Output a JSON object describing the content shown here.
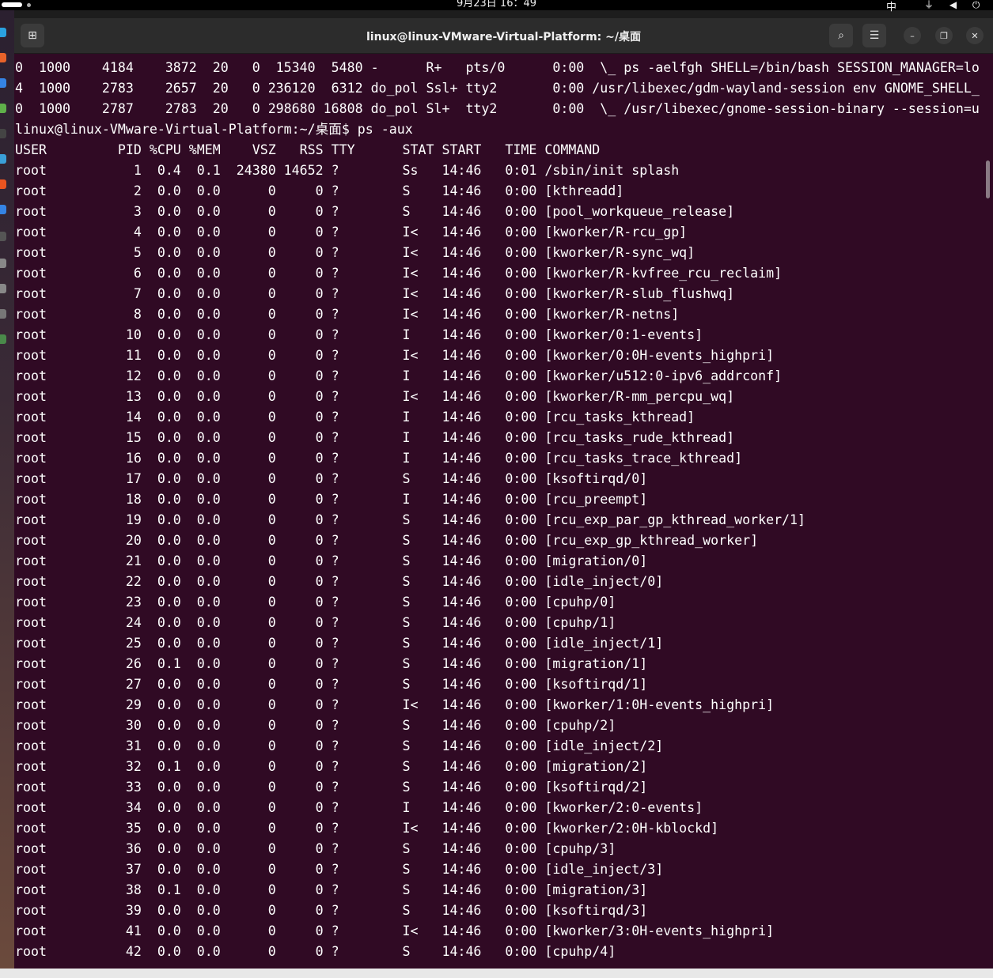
{
  "topbar": {
    "clock": "9月23日 16：49",
    "input_method": "中",
    "system_icons": "⏚ ◀ ⏻"
  },
  "window": {
    "title": "linux@linux-VMware-Virtual-Platform: ~/桌面",
    "new_tab_icon": "⊞",
    "search_icon": "⌕",
    "menu_icon": "☰",
    "minimize_icon": "–",
    "maximize_icon": "❐",
    "close_icon": "✕"
  },
  "terminal": {
    "lines": [
      "0  1000    4184    3872  20   0  15340  5480 -      R+   pts/0      0:00  \\_ ps -aelfgh SHELL=/bin/bash SESSION_MANAGER=lo",
      "4  1000    2783    2657  20   0 236120  6312 do_pol Ssl+ tty2       0:00 /usr/libexec/gdm-wayland-session env GNOME_SHELL_",
      "0  1000    2787    2783  20   0 298680 16808 do_pol Sl+  tty2       0:00  \\_ /usr/libexec/gnome-session-binary --session=u",
      "linux@linux-VMware-Virtual-Platform:~/桌面$ ps -aux",
      "USER         PID %CPU %MEM    VSZ   RSS TTY      STAT START   TIME COMMAND",
      "root           1  0.4  0.1  24380 14652 ?        Ss   14:46   0:01 /sbin/init splash",
      "root           2  0.0  0.0      0     0 ?        S    14:46   0:00 [kthreadd]",
      "root           3  0.0  0.0      0     0 ?        S    14:46   0:00 [pool_workqueue_release]",
      "root           4  0.0  0.0      0     0 ?        I<   14:46   0:00 [kworker/R-rcu_gp]",
      "root           5  0.0  0.0      0     0 ?        I<   14:46   0:00 [kworker/R-sync_wq]",
      "root           6  0.0  0.0      0     0 ?        I<   14:46   0:00 [kworker/R-kvfree_rcu_reclaim]",
      "root           7  0.0  0.0      0     0 ?        I<   14:46   0:00 [kworker/R-slub_flushwq]",
      "root           8  0.0  0.0      0     0 ?        I<   14:46   0:00 [kworker/R-netns]",
      "root          10  0.0  0.0      0     0 ?        I    14:46   0:00 [kworker/0:1-events]",
      "root          11  0.0  0.0      0     0 ?        I<   14:46   0:00 [kworker/0:0H-events_highpri]",
      "root          12  0.0  0.0      0     0 ?        I    14:46   0:00 [kworker/u512:0-ipv6_addrconf]",
      "root          13  0.0  0.0      0     0 ?        I<   14:46   0:00 [kworker/R-mm_percpu_wq]",
      "root          14  0.0  0.0      0     0 ?        I    14:46   0:00 [rcu_tasks_kthread]",
      "root          15  0.0  0.0      0     0 ?        I    14:46   0:00 [rcu_tasks_rude_kthread]",
      "root          16  0.0  0.0      0     0 ?        I    14:46   0:00 [rcu_tasks_trace_kthread]",
      "root          17  0.0  0.0      0     0 ?        S    14:46   0:00 [ksoftirqd/0]",
      "root          18  0.0  0.0      0     0 ?        I    14:46   0:00 [rcu_preempt]",
      "root          19  0.0  0.0      0     0 ?        S    14:46   0:00 [rcu_exp_par_gp_kthread_worker/1]",
      "root          20  0.0  0.0      0     0 ?        S    14:46   0:00 [rcu_exp_gp_kthread_worker]",
      "root          21  0.0  0.0      0     0 ?        S    14:46   0:00 [migration/0]",
      "root          22  0.0  0.0      0     0 ?        S    14:46   0:00 [idle_inject/0]",
      "root          23  0.0  0.0      0     0 ?        S    14:46   0:00 [cpuhp/0]",
      "root          24  0.0  0.0      0     0 ?        S    14:46   0:00 [cpuhp/1]",
      "root          25  0.0  0.0      0     0 ?        S    14:46   0:00 [idle_inject/1]",
      "root          26  0.1  0.0      0     0 ?        S    14:46   0:00 [migration/1]",
      "root          27  0.0  0.0      0     0 ?        S    14:46   0:00 [ksoftirqd/1]",
      "root          29  0.0  0.0      0     0 ?        I<   14:46   0:00 [kworker/1:0H-events_highpri]",
      "root          30  0.0  0.0      0     0 ?        S    14:46   0:00 [cpuhp/2]",
      "root          31  0.0  0.0      0     0 ?        S    14:46   0:00 [idle_inject/2]",
      "root          32  0.1  0.0      0     0 ?        S    14:46   0:00 [migration/2]",
      "root          33  0.0  0.0      0     0 ?        S    14:46   0:00 [ksoftirqd/2]",
      "root          34  0.0  0.0      0     0 ?        I    14:46   0:00 [kworker/2:0-events]",
      "root          35  0.0  0.0      0     0 ?        I<   14:46   0:00 [kworker/2:0H-kblockd]",
      "root          36  0.0  0.0      0     0 ?        S    14:46   0:00 [cpuhp/3]",
      "root          37  0.0  0.0      0     0 ?        S    14:46   0:00 [idle_inject/3]",
      "root          38  0.1  0.0      0     0 ?        S    14:46   0:00 [migration/3]",
      "root          39  0.0  0.0      0     0 ?        S    14:46   0:00 [ksoftirqd/3]",
      "root          41  0.0  0.0      0     0 ?        I<   14:46   0:00 [kworker/3:0H-events_highpri]",
      "root          42  0.0  0.0      0     0 ?        S    14:46   0:00 [cpuhp/4]"
    ]
  },
  "colors": {
    "terminal_bg": "#300a24",
    "headerbar_bg": "#2c2c2c",
    "text": "#ffffff"
  }
}
